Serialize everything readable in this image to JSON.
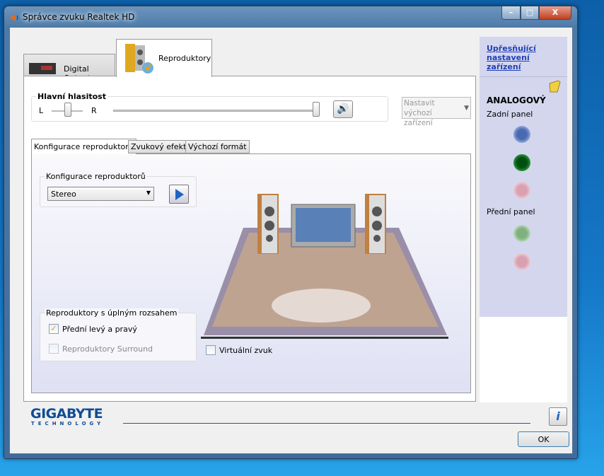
{
  "window": {
    "title": "Správce zvuku Realtek HD",
    "minimize": "–",
    "maximize": "□",
    "close": "X"
  },
  "tabs": [
    {
      "label": "Digital Output",
      "active": false
    },
    {
      "label": "Reproduktory",
      "active": true
    }
  ],
  "volume": {
    "label": "Hlavní hlasitost",
    "left": "L",
    "right": "R",
    "balance": 0.5,
    "level": 1.0
  },
  "default_device": {
    "label": "Nastavit výchozí zařízení"
  },
  "subtabs": [
    {
      "label": "Konfigurace reproduktorů"
    },
    {
      "label": "Zvukový efekt"
    },
    {
      "label": "Výchozí formát"
    }
  ],
  "config": {
    "group_label": "Konfigurace reproduktorů",
    "selected": "Stereo"
  },
  "fullrange": {
    "group_label": "Reproduktory s úplným rozsahem",
    "front": {
      "label": "Přední levý a pravý",
      "checked": true
    },
    "surround": {
      "label": "Reproduktory Surround",
      "checked": false,
      "disabled": true
    }
  },
  "virtual": {
    "label": "Virtuální zvuk",
    "checked": false
  },
  "right_panel": {
    "link": "Upřesňující nastavení zařízení",
    "analog": "ANALOGOVÝ",
    "rear": "Zadní panel",
    "front": "Přední panel",
    "rear_jacks": [
      "#6d8fd0",
      "#0a7a1e",
      "#e8b2c0"
    ],
    "front_jacks": [
      "#9ccc9c",
      "#e8b2c0"
    ]
  },
  "footer": {
    "logo": "GIGABYTE",
    "logo_sub": "TECHNOLOGY",
    "ok": "OK",
    "info": "i"
  }
}
